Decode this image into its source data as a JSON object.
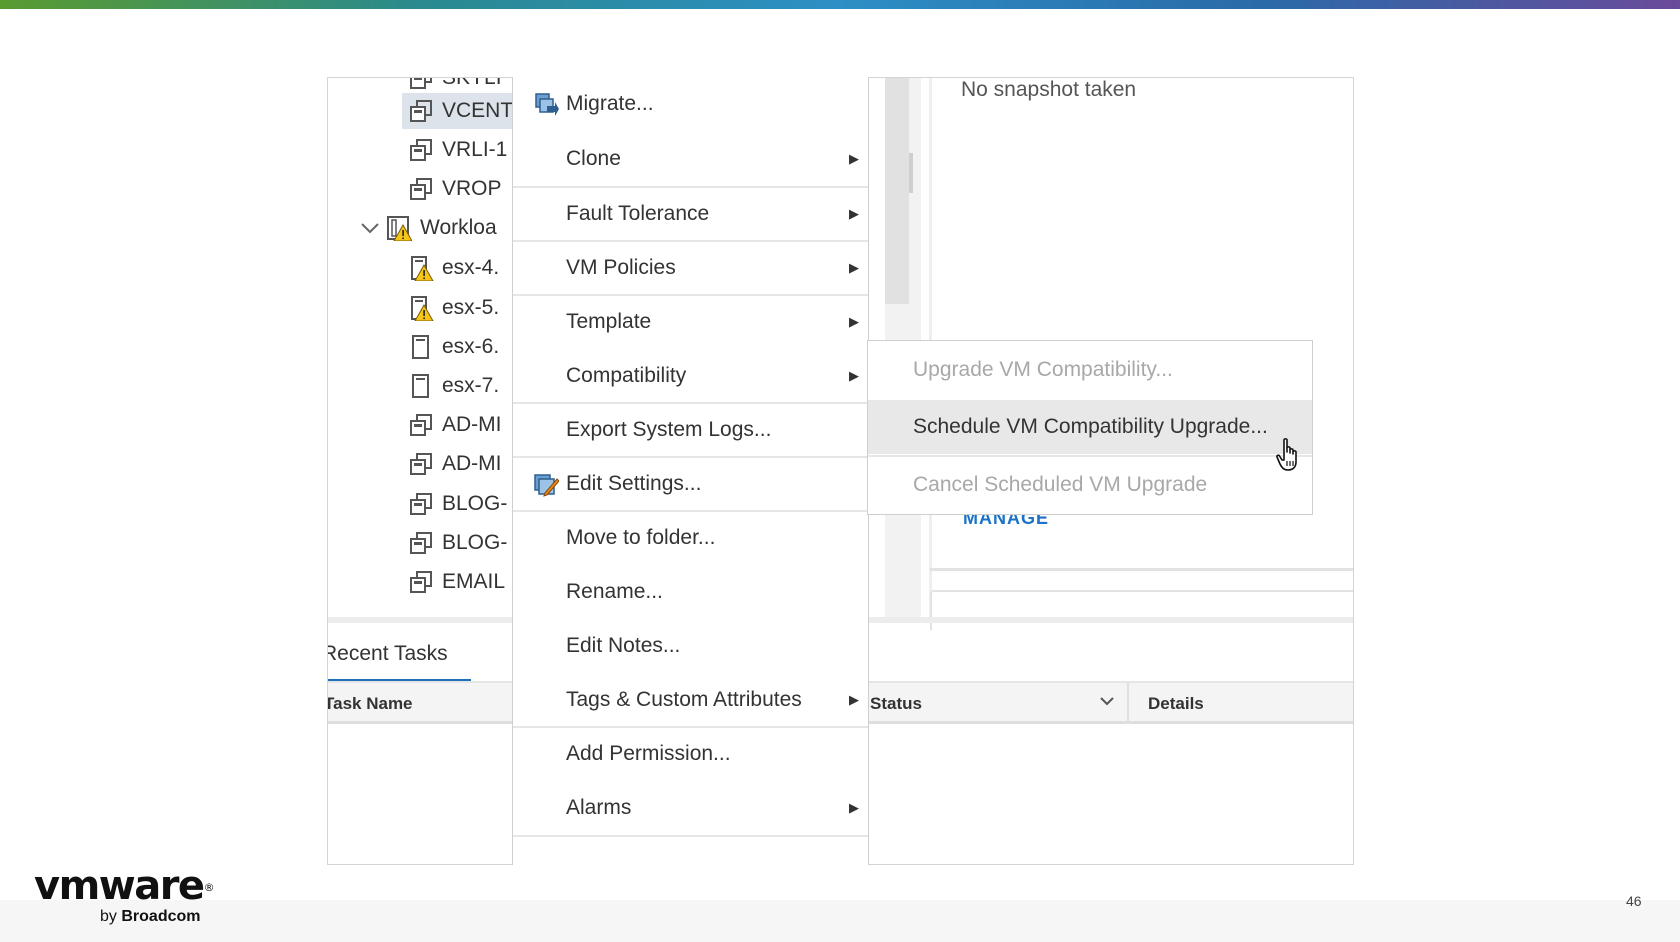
{
  "inventory_tree": {
    "items": [
      {
        "label": "SKYLI",
        "icon": "vm-icon",
        "indent": 1,
        "selected": false
      },
      {
        "label": "VCENT",
        "icon": "vm-icon",
        "indent": 1,
        "selected": true
      },
      {
        "label": "VRLI-1",
        "icon": "vm-icon",
        "indent": 1,
        "selected": false
      },
      {
        "label": "VROP",
        "icon": "vm-icon",
        "indent": 1,
        "selected": false
      },
      {
        "label": "Workloa",
        "icon": "cluster-warning-icon",
        "indent": 0,
        "selected": false,
        "expanded": true
      },
      {
        "label": "esx-4.",
        "icon": "host-warning-icon",
        "indent": 1,
        "selected": false
      },
      {
        "label": "esx-5.",
        "icon": "host-warning-icon",
        "indent": 1,
        "selected": false
      },
      {
        "label": "esx-6.",
        "icon": "host-icon",
        "indent": 1,
        "selected": false
      },
      {
        "label": "esx-7.",
        "icon": "host-icon",
        "indent": 1,
        "selected": false
      },
      {
        "label": "AD-MI",
        "icon": "vm-icon",
        "indent": 1,
        "selected": false
      },
      {
        "label": "AD-MI",
        "icon": "vm-icon",
        "indent": 1,
        "selected": false
      },
      {
        "label": "BLOG-",
        "icon": "vm-icon",
        "indent": 1,
        "selected": false
      },
      {
        "label": "BLOG-",
        "icon": "vm-icon",
        "indent": 1,
        "selected": false
      },
      {
        "label": "EMAIL",
        "icon": "vm-icon",
        "indent": 1,
        "selected": false
      }
    ]
  },
  "snapshot_panel": {
    "text": "No snapshot taken",
    "manage_label": "MANAGE"
  },
  "recent_tasks": {
    "tab_label": "Recent Tasks",
    "columns": {
      "task_name": "Task Name",
      "status": "Status",
      "details": "Details"
    }
  },
  "context_menu": {
    "items": [
      {
        "label": "Migrate...",
        "icon": "migrate-icon",
        "submenu": false
      },
      {
        "label": "Clone",
        "submenu": true
      },
      {
        "label": "Fault Tolerance",
        "submenu": true
      },
      {
        "label": "VM Policies",
        "submenu": true
      },
      {
        "label": "Template",
        "submenu": true
      },
      {
        "label": "Compatibility",
        "submenu": true
      },
      {
        "label": "Export System Logs...",
        "submenu": false
      },
      {
        "label": "Edit Settings...",
        "icon": "edit-settings-icon",
        "submenu": false
      },
      {
        "label": "Move to folder...",
        "submenu": false
      },
      {
        "label": "Rename...",
        "submenu": false
      },
      {
        "label": "Edit Notes...",
        "submenu": false
      },
      {
        "label": "Tags & Custom Attributes",
        "submenu": true
      },
      {
        "label": "Add Permission...",
        "submenu": false
      },
      {
        "label": "Alarms",
        "submenu": true
      }
    ]
  },
  "compatibility_submenu": {
    "items": [
      {
        "label": "Upgrade VM Compatibility...",
        "enabled": false
      },
      {
        "label": "Schedule VM Compatibility Upgrade...",
        "enabled": true,
        "hovered": true
      },
      {
        "label": "Cancel Scheduled VM Upgrade",
        "enabled": false
      }
    ]
  },
  "branding": {
    "logo_text": "vmware",
    "logo_mark": "®",
    "by_text": "by",
    "company": "Broadcom"
  },
  "page_number": "46",
  "colors": {
    "accent_blue": "#1f6fb8",
    "link_blue": "#1a73c8",
    "warning_yellow": "#f5c518",
    "disabled_text": "#a8a8a8"
  }
}
